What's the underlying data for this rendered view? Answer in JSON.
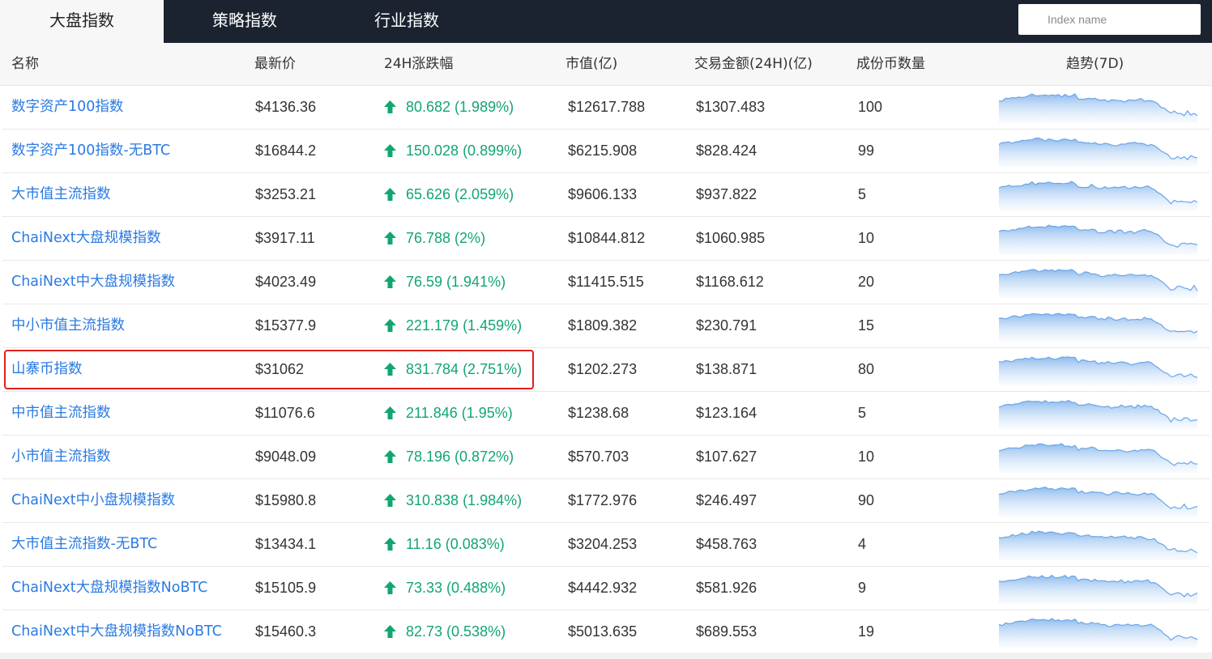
{
  "tabs": [
    {
      "label": "大盘指数",
      "active": true
    },
    {
      "label": "策略指数",
      "active": false
    },
    {
      "label": "行业指数",
      "active": false
    }
  ],
  "search": {
    "placeholder": "Index name",
    "value": ""
  },
  "table": {
    "headers": [
      "名称",
      "最新价",
      "24H涨跌幅",
      "市值(亿)",
      "交易金额(24H)(亿)",
      "成份币数量",
      "趋势(7D)"
    ],
    "rows": [
      {
        "name": "数字资产100指数",
        "price": "$4136.36",
        "change": "80.682 (1.989%)",
        "mcap": "$12617.788",
        "volume": "$1307.483",
        "count": "100"
      },
      {
        "name": "数字资产100指数-无BTC",
        "price": "$16844.2",
        "change": "150.028 (0.899%)",
        "mcap": "$6215.908",
        "volume": "$828.424",
        "count": "99"
      },
      {
        "name": "大市值主流指数",
        "price": "$3253.21",
        "change": "65.626 (2.059%)",
        "mcap": "$9606.133",
        "volume": "$937.822",
        "count": "5"
      },
      {
        "name": "ChaiNext大盘规模指数",
        "price": "$3917.11",
        "change": "76.788 (2%)",
        "mcap": "$10844.812",
        "volume": "$1060.985",
        "count": "10"
      },
      {
        "name": "ChaiNext中大盘规模指数",
        "price": "$4023.49",
        "change": "76.59 (1.941%)",
        "mcap": "$11415.515",
        "volume": "$1168.612",
        "count": "20"
      },
      {
        "name": "中小市值主流指数",
        "price": "$15377.9",
        "change": "221.179 (1.459%)",
        "mcap": "$1809.382",
        "volume": "$230.791",
        "count": "15"
      },
      {
        "name": "山寨币指数",
        "price": "$31062",
        "change": "831.784 (2.751%)",
        "mcap": "$1202.273",
        "volume": "$138.871",
        "count": "80"
      },
      {
        "name": "中市值主流指数",
        "price": "$11076.6",
        "change": "211.846 (1.95%)",
        "mcap": "$1238.68",
        "volume": "$123.164",
        "count": "5"
      },
      {
        "name": "小市值主流指数",
        "price": "$9048.09",
        "change": "78.196 (0.872%)",
        "mcap": "$570.703",
        "volume": "$107.627",
        "count": "10"
      },
      {
        "name": "ChaiNext中小盘规模指数",
        "price": "$15980.8",
        "change": "310.838 (1.984%)",
        "mcap": "$1772.976",
        "volume": "$246.497",
        "count": "90"
      },
      {
        "name": "大市值主流指数-无BTC",
        "price": "$13434.1",
        "change": "11.16 (0.083%)",
        "mcap": "$3204.253",
        "volume": "$458.763",
        "count": "4"
      },
      {
        "name": "ChaiNext大盘规模指数NoBTC",
        "price": "$15105.9",
        "change": "73.33 (0.488%)",
        "mcap": "$4442.932",
        "volume": "$581.926",
        "count": "9"
      },
      {
        "name": "ChaiNext中大盘规模指数NoBTC",
        "price": "$15460.3",
        "change": "82.73 (0.538%)",
        "mcap": "$5013.635",
        "volume": "$689.553",
        "count": "19"
      }
    ],
    "highlighted_row": 6
  },
  "colors": {
    "topbar": "#1b2331",
    "link": "#2a7ae2",
    "up": "#12a66f",
    "highlight": "#e0201c",
    "sparkline_line": "#6aa5e8",
    "sparkline_fill": "#cfe3fa"
  },
  "icons": {
    "change_direction": "up-arrow-icon"
  }
}
